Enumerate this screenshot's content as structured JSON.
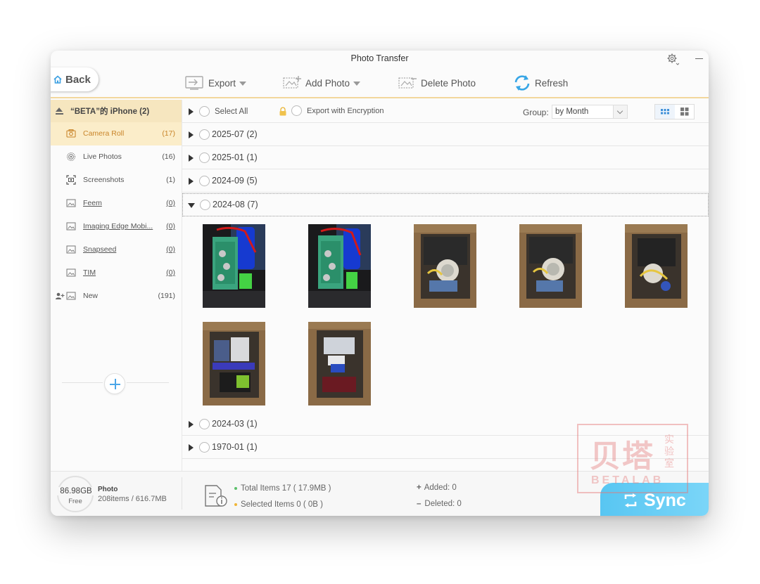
{
  "window": {
    "title": "Photo Transfer"
  },
  "toolbar": {
    "back_label": "Back",
    "export_label": "Export",
    "add_photo_label": "Add Photo",
    "delete_photo_label": "Delete Photo",
    "refresh_label": "Refresh"
  },
  "sidebar": {
    "device": "“BETA”的 iPhone (2)",
    "albums": [
      {
        "name": "Camera Roll",
        "count": "(17)",
        "icon": "camera-icon",
        "active": true
      },
      {
        "name": "Live Photos",
        "count": "(16)",
        "icon": "live-photo-icon"
      },
      {
        "name": "Screenshots",
        "count": "(1)",
        "icon": "screenshot-icon"
      },
      {
        "name": "Feem",
        "count": "(0)",
        "icon": "album-icon"
      },
      {
        "name": "Imaging Edge Mobi...",
        "count": "(0)",
        "icon": "album-icon"
      },
      {
        "name": "Snapseed",
        "count": "(0)",
        "icon": "album-icon"
      },
      {
        "name": "TIM",
        "count": "(0)",
        "icon": "album-icon"
      },
      {
        "name": "New",
        "count": "(191)",
        "icon": "album-icon"
      }
    ]
  },
  "main": {
    "select_all": "Select All",
    "export_encryption": "Export with Encryption",
    "group_label": "Group:",
    "group_value": "by Month",
    "groups": [
      {
        "label": "2025-07 (2)"
      },
      {
        "label": "2025-01 (1)"
      },
      {
        "label": "2024-09 (5)"
      },
      {
        "label": "2024-08 (7)",
        "expanded": true
      },
      {
        "label": "2024-03 (1)"
      },
      {
        "label": "1970-01 (1)"
      }
    ]
  },
  "footer": {
    "storage_free": "86.98GB",
    "free_label": "Free",
    "category": "Photo",
    "category_stats": "208items / 616.7MB",
    "total_items": "Total Items 17 ( 17.9MB )",
    "selected_items": "Selected Items 0 ( 0B )",
    "added": "Added: 0",
    "deleted": "Deleted: 0",
    "sync_label": "Sync"
  },
  "watermark": {
    "big": "贝塔",
    "small": "实验室",
    "sub": "BETALAB"
  },
  "colors": {
    "accent": "#f2d79c",
    "active_bg": "#fbedc9",
    "active_text": "#c9852a",
    "sync": "#58c6f2",
    "link_blue": "#4aa6e8"
  }
}
